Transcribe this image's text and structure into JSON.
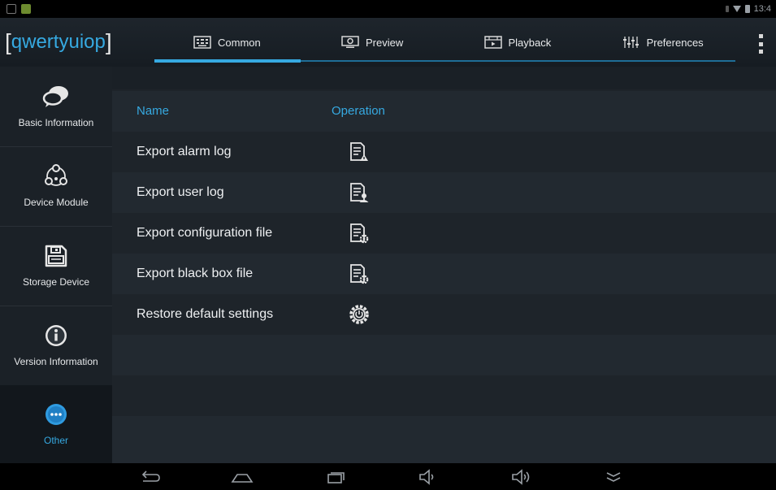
{
  "status_bar": {
    "time": "13:4"
  },
  "app": {
    "logo_text": "qwertyuiop",
    "logo_open": "[",
    "logo_close": "]"
  },
  "tabs": [
    {
      "label": "Common",
      "icon": "grid-icon",
      "active": true
    },
    {
      "label": "Preview",
      "icon": "camera-icon",
      "active": false
    },
    {
      "label": "Playback",
      "icon": "film-icon",
      "active": false
    },
    {
      "label": "Preferences",
      "icon": "sliders-icon",
      "active": false
    }
  ],
  "sidebar": {
    "items": [
      {
        "label": "Basic Information",
        "icon": "chat-bubbles-icon"
      },
      {
        "label": "Device Module",
        "icon": "module-network-icon"
      },
      {
        "label": "Storage Device",
        "icon": "floppy-disk-icon"
      },
      {
        "label": "Version Information",
        "icon": "info-icon"
      },
      {
        "label": "Other",
        "icon": "more-icon",
        "active": true
      }
    ]
  },
  "table": {
    "headers": {
      "name": "Name",
      "operation": "Operation"
    },
    "rows": [
      {
        "name": "Export alarm log",
        "icon": "export-alarm-log-icon"
      },
      {
        "name": "Export user log",
        "icon": "export-user-log-icon"
      },
      {
        "name": "Export configuration file",
        "icon": "export-config-file-icon"
      },
      {
        "name": "Export black box file",
        "icon": "export-blackbox-file-icon"
      },
      {
        "name": "Restore default settings",
        "icon": "restore-settings-icon"
      }
    ]
  },
  "nav_bar": {
    "buttons": [
      "back-icon",
      "home-icon",
      "recents-icon",
      "volume-down-icon",
      "volume-up-icon",
      "collapse-icon"
    ]
  },
  "colors": {
    "accent": "#36a9e1",
    "background": "#1e242a",
    "sidebar": "#1b2127"
  }
}
